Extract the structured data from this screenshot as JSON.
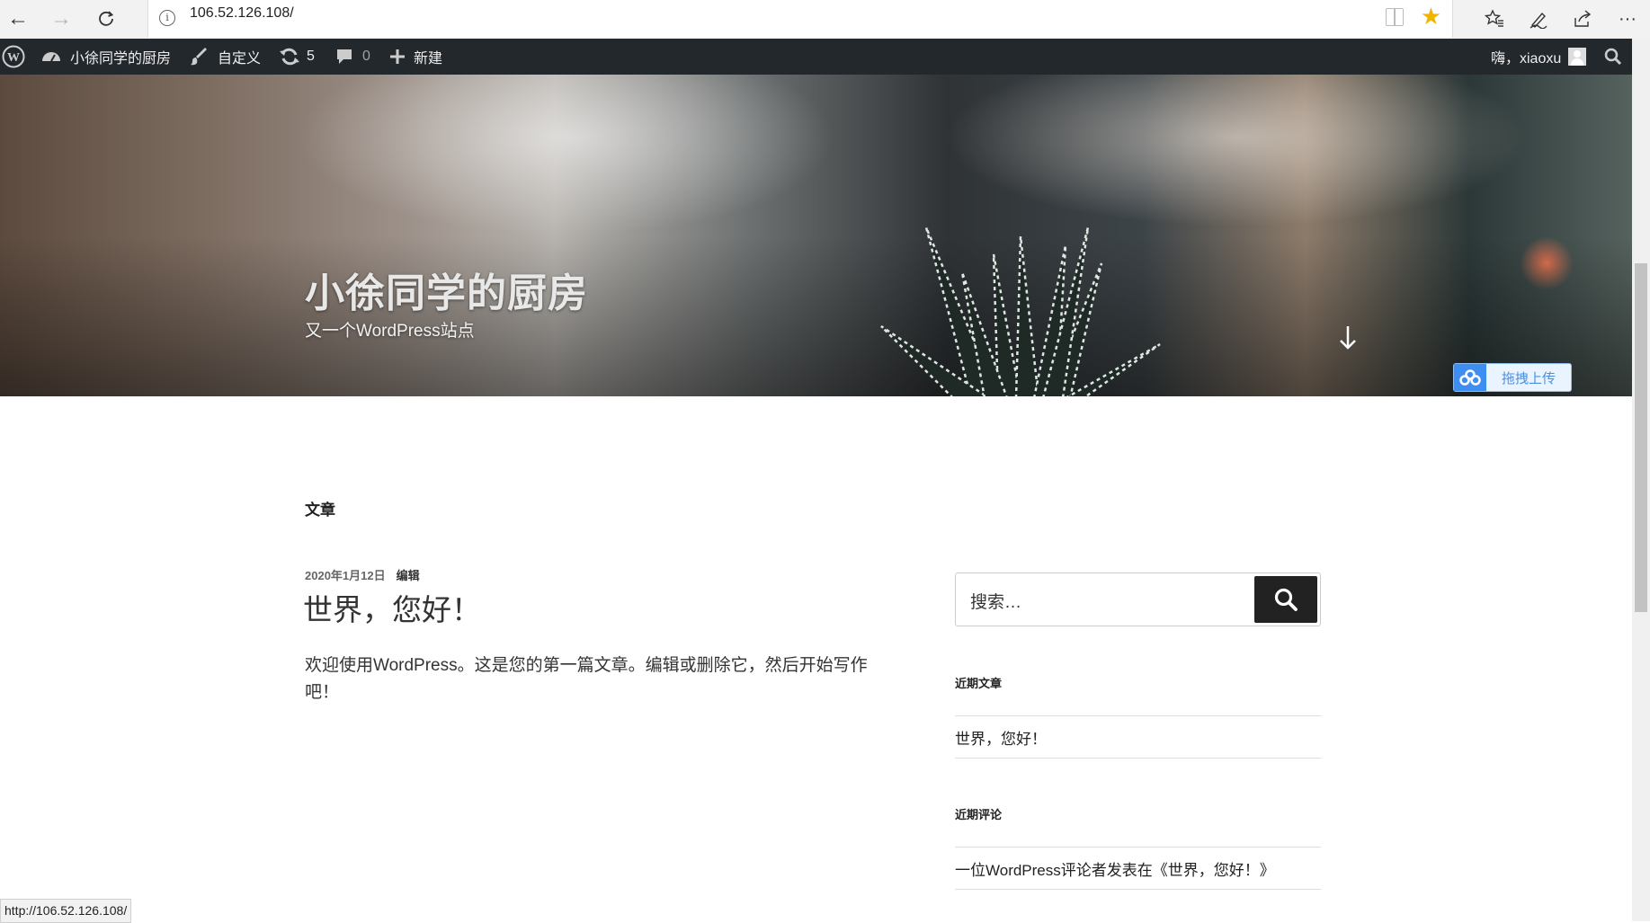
{
  "browser": {
    "url": "106.52.126.108/",
    "status_url": "http://106.52.126.108/"
  },
  "adminbar": {
    "site_name": "小徐同学的厨房",
    "customize": "自定义",
    "updates_count": "5",
    "comments_count": "0",
    "new": "新建",
    "greeting": "嗨，xiaoxu"
  },
  "header": {
    "title": "小徐同学的厨房",
    "description": "又一个WordPress站点",
    "upload_label": "拖拽上传"
  },
  "main": {
    "section_title": "文章",
    "post": {
      "date": "2020年1月12日",
      "edit": "编辑",
      "title": "世界，您好！",
      "excerpt": "欢迎使用WordPress。这是您的第一篇文章。编辑或删除它，然后开始写作吧！"
    }
  },
  "sidebar": {
    "search_placeholder": "搜索…",
    "recent_posts_title": "近期文章",
    "recent_posts": [
      "世界，您好！"
    ],
    "recent_comments_title": "近期评论",
    "recent_comments": [
      "一位WordPress评论者发表在《世界，您好！》"
    ]
  },
  "colors": {
    "adminbar_bg": "#23282d",
    "star": "#f0b400",
    "search_button": "#222222"
  }
}
